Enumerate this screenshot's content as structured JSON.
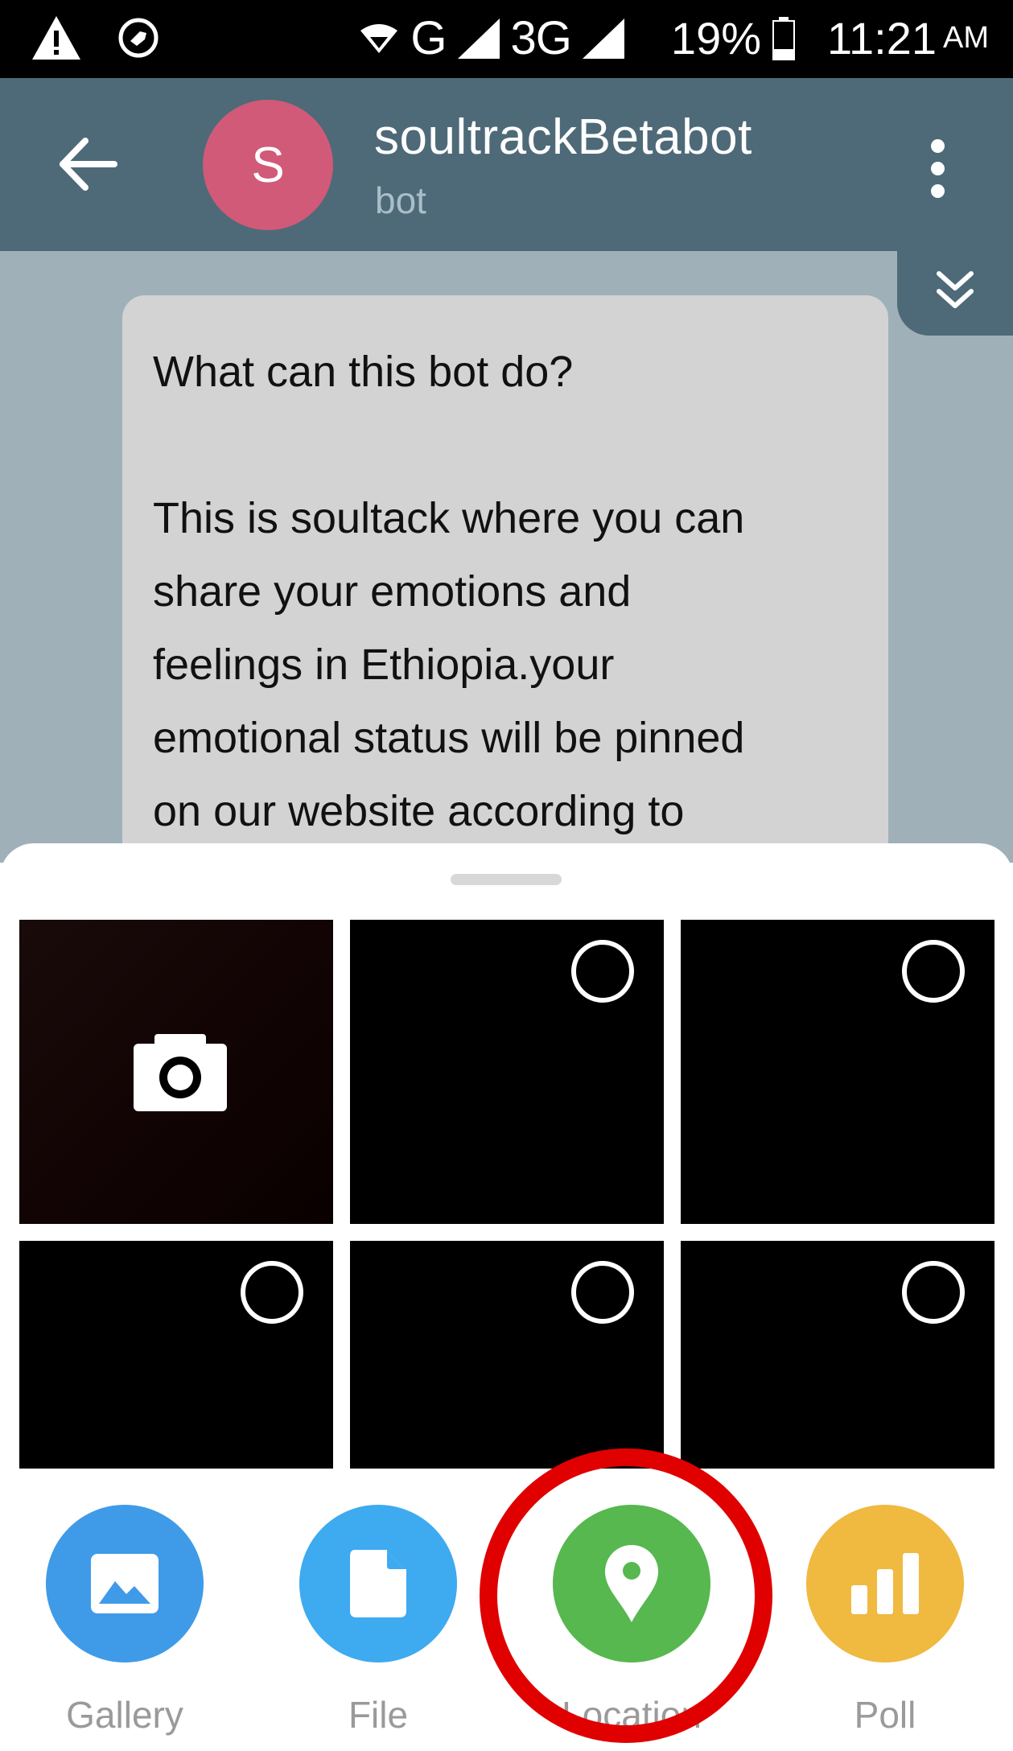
{
  "status_bar": {
    "icons_left": [
      "warning-icon",
      "notification-icon"
    ],
    "network_1": "G",
    "network_2": "3G",
    "battery": "19%",
    "time": "11:21",
    "ampm": "AM"
  },
  "header": {
    "avatar_letter": "S",
    "title": "soultrackBetabot",
    "subtitle": "bot",
    "avatar_color": "#d15a79",
    "bar_color": "#4e6a78"
  },
  "message": {
    "question": "What can this bot do?",
    "lines": [
      "This is soultack where you can",
      "share your emotions and",
      "feelings in Ethiopia.your",
      "emotional status will be pinned",
      "on our website according to"
    ]
  },
  "gallery": {
    "tiles": [
      "camera",
      "photo",
      "photo",
      "photo",
      "photo",
      "photo"
    ]
  },
  "actions": [
    {
      "label": "Gallery",
      "color": "#3f9be8",
      "icon": "image-icon"
    },
    {
      "label": "File",
      "color": "#3eaaf0",
      "icon": "file-icon"
    },
    {
      "label": "Location",
      "color": "#56b84f",
      "icon": "location-pin-icon"
    },
    {
      "label": "Poll",
      "color": "#f0b940",
      "icon": "poll-icon"
    }
  ],
  "annotation_color": "#e00000"
}
